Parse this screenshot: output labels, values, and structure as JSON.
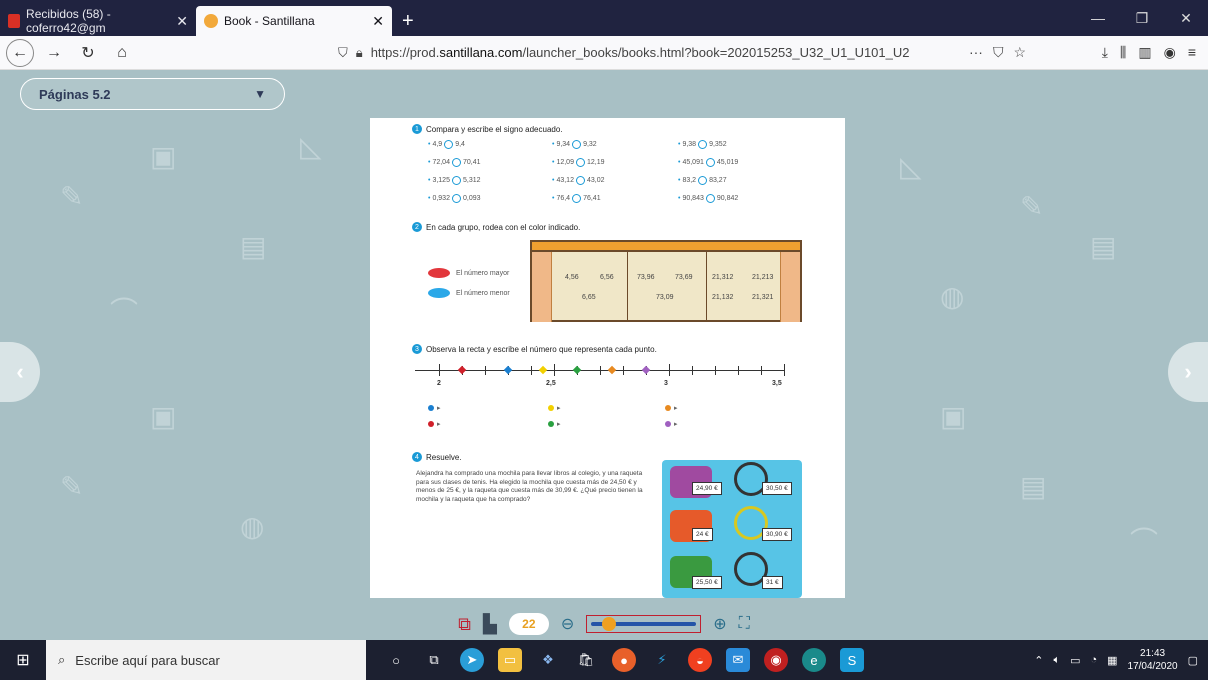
{
  "browser": {
    "tabs": [
      {
        "label": "Recibidos (58) - coferro42@gm",
        "close": "✕"
      },
      {
        "label": "Book - Santillana",
        "close": "✕"
      }
    ],
    "new_tab": "+",
    "url_prefix": "https://prod.",
    "url_domain": "santillana.com",
    "url_path": "/launcher_books/books.html?book=202015253_U32_U1_U101_U2",
    "url_more": "···"
  },
  "viewer": {
    "pages_label": "Páginas 5.2",
    "page_number": "22",
    "zoom_level": 0.1
  },
  "book": {
    "ex1": {
      "num": "1",
      "title": "Compara y escribe el signo adecuado.",
      "items": [
        [
          "4,9",
          "9,4"
        ],
        [
          "72,04",
          "70,41"
        ],
        [
          "3,125",
          "5,312"
        ],
        [
          "0,932",
          "0,093"
        ],
        [
          "9,34",
          "9,32"
        ],
        [
          "12,09",
          "12,19"
        ],
        [
          "43,12",
          "43,02"
        ],
        [
          "76,4",
          "76,41"
        ],
        [
          "9,38",
          "9,352"
        ],
        [
          "45,091",
          "45,019"
        ],
        [
          "83,2",
          "83,27"
        ],
        [
          "90,843",
          "90,842"
        ]
      ]
    },
    "ex2": {
      "num": "2",
      "title": "En cada grupo, rodea con el color indicado.",
      "legend_max": "El número mayor",
      "legend_min": "El número menor",
      "groups": [
        [
          "4,56",
          "6,56",
          "6,65"
        ],
        [
          "73,96",
          "73,69",
          "73,09"
        ],
        [
          "21,312",
          "21,213",
          "21,132",
          "21,321"
        ]
      ]
    },
    "ex3": {
      "num": "3",
      "title": "Observa la recta y escribe el número que representa cada punto.",
      "labels": [
        "2",
        "2,5",
        "3",
        "3,5"
      ],
      "arrow": "▸"
    },
    "ex4": {
      "num": "4",
      "title": "Resuelve.",
      "text": "Alejandra ha comprado una mochila para llevar libros al colegio, y una raqueta para sus clases de tenis. Ha elegido la mochila que cuesta más de 24,50 € y menos de 25 €, y la raqueta que cuesta más de 30,99 €. ¿Qué precio tienen la mochila y la raqueta que ha comprado?",
      "prices": [
        "24,90 €",
        "30,50 €",
        "24 €",
        "30,90 €",
        "25,50 €",
        "31 €"
      ]
    }
  },
  "taskbar": {
    "search_placeholder": "Escribe aquí para buscar",
    "time": "21:43",
    "date": "17/04/2020"
  },
  "colors": {
    "accent": "#1a9ad6",
    "red": "#c02030",
    "orange": "#f0a020"
  }
}
